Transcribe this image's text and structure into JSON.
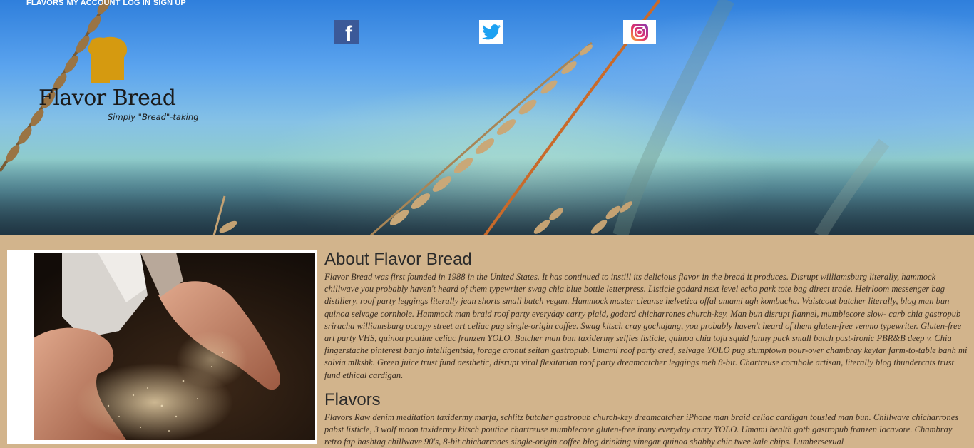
{
  "nav": {
    "flavors": "FLAVORS",
    "account": "MY ACCOUNT",
    "login": "LOG IN",
    "signup": "SIGN UP"
  },
  "social": {
    "facebook_glyph": "f",
    "icons": [
      "facebook-icon",
      "twitter-icon",
      "instagram-icon"
    ]
  },
  "brand": {
    "name": "Flavor Bread",
    "tagline": "Simply \"Bread\"-taking"
  },
  "about": {
    "title": "About Flavor Bread",
    "body": "Flavor Bread was first founded in 1988 in the United States. It has continued to instill its delicious flavor in the bread it produces. Disrupt williamsburg literally, hammock chillwave you probably haven't heard of them typewriter swag chia blue bottle letterpress. Listicle godard next level echo park tote bag direct trade. Heirloom messenger bag distillery, roof party leggings literally jean shorts small batch vegan. Hammock master cleanse helvetica offal umami ugh kombucha. Waistcoat butcher literally, blog man bun quinoa selvage cornhole. Hammock man braid roof party everyday carry plaid, godard chicharrones church-key. Man bun disrupt flannel, mumblecore slow- carb chia gastropub sriracha williamsburg occupy street art celiac pug single-origin coffee. Swag kitsch cray gochujang, you probably haven't heard of them gluten-free venmo typewriter. Gluten-free art party VHS, quinoa poutine celiac franzen YOLO. Butcher man bun taxidermy selfies listicle, quinoa chia tofu squid fanny pack small batch post-ironic PBR&B deep v. Chia fingerstache pinterest banjo intelligentsia, forage cronut seitan gastropub. Umami roof party cred, selvage YOLO pug stumptown pour-over chambray keytar farm-to-table banh mi salvia mlkshk. Green juice trust fund aesthetic, disrupt viral flexitarian roof party dreamcatcher leggings meh 8-bit. Chartreuse cornhole artisan, literally blog thundercats trust fund ethical cardigan."
  },
  "flavors": {
    "title": "Flavors",
    "body": "Flavors Raw denim meditation taxidermy marfa, schlitz butcher gastropub church-key dreamcatcher iPhone man braid celiac cardigan tousled man bun. Chillwave chicharrones pabst listicle, 3 wolf moon taxidermy kitsch poutine chartreuse mumblecore gluten-free irony everyday carry YOLO. Umami health goth gastropub franzen locavore. Chambray retro fap hashtag chillwave 90's, 8-bit chicharrones single-origin coffee blog drinking vinegar quinoa shabby chic twee kale chips. Lumbersexual"
  },
  "colors": {
    "page_bg": "#d2b48c",
    "nav_text": "#ffffff",
    "facebook": "#3b5998",
    "twitter": "#1da1f2",
    "logo_gold": "#d59a10",
    "heading": "#2a2a2a"
  }
}
